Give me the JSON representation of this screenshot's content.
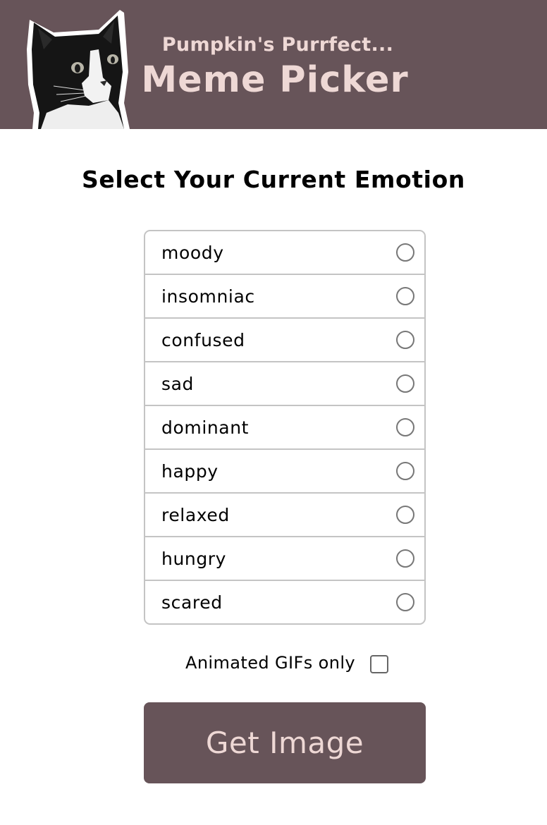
{
  "header": {
    "subtitle": "Pumpkin's Purrfect...",
    "title": "Meme Picker",
    "logo": "cat-photo"
  },
  "heading": "Select Your Current Emotion",
  "emotions": [
    {
      "label": "moody",
      "selected": false
    },
    {
      "label": "insomniac",
      "selected": false
    },
    {
      "label": "confused",
      "selected": false
    },
    {
      "label": "sad",
      "selected": false
    },
    {
      "label": "dominant",
      "selected": false
    },
    {
      "label": "happy",
      "selected": false
    },
    {
      "label": "relaxed",
      "selected": false
    },
    {
      "label": "hungry",
      "selected": false
    },
    {
      "label": "scared",
      "selected": false
    }
  ],
  "gif_option": {
    "label": "Animated GIFs only",
    "checked": false
  },
  "button": {
    "label": "Get Image"
  },
  "colors": {
    "brand": "#675459",
    "accent_text": "#eed8d5",
    "border": "#c4c4c4"
  }
}
